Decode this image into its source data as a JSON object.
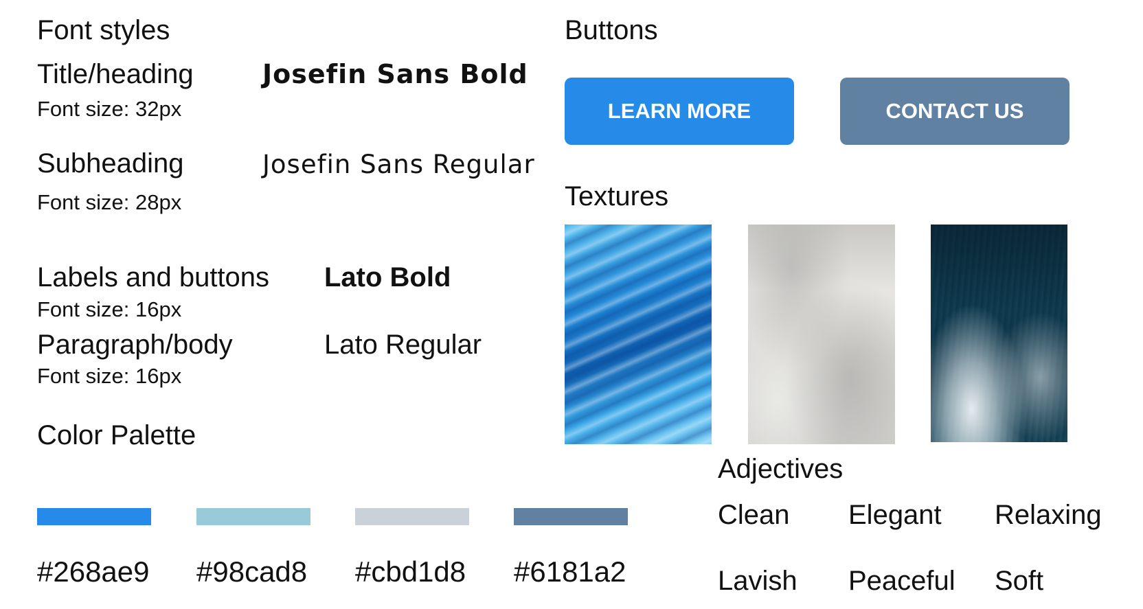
{
  "font_styles": {
    "heading": "Font styles",
    "rows": [
      {
        "label": "Title/heading",
        "size": "Font size: 32px",
        "font": "Josefin Sans Bold"
      },
      {
        "label": "Subheading",
        "size": "Font size: 28px",
        "font": "Josefin Sans Regular"
      },
      {
        "label": "Labels and buttons",
        "size": "Font size: 16px",
        "font": "Lato Bold"
      },
      {
        "label": "Paragraph/body",
        "size": "Font size: 16px",
        "font": "Lato Regular"
      }
    ]
  },
  "buttons": {
    "heading": "Buttons",
    "learn_more": "LEARN MORE",
    "contact_us": "CONTACT US",
    "colors": {
      "primary": "#268ae9",
      "secondary": "#6181a2"
    }
  },
  "textures": {
    "heading": "Textures",
    "items": [
      "blue-water-texture",
      "white-concrete-texture",
      "ocean-waves-texture"
    ]
  },
  "palette": {
    "heading": "Color Palette",
    "colors": [
      {
        "hex": "#268ae9",
        "label": "#268ae9"
      },
      {
        "hex": "#98cad8",
        "label": "#98cad8"
      },
      {
        "hex": "#cbd1d8",
        "label": "#cbd1d8"
      },
      {
        "hex": "#6181a2",
        "label": "#6181a2"
      }
    ]
  },
  "adjectives": {
    "heading": "Adjectives",
    "words": [
      "Clean",
      "Elegant",
      "Relaxing",
      "Lavish",
      "Peaceful",
      "Soft"
    ]
  }
}
